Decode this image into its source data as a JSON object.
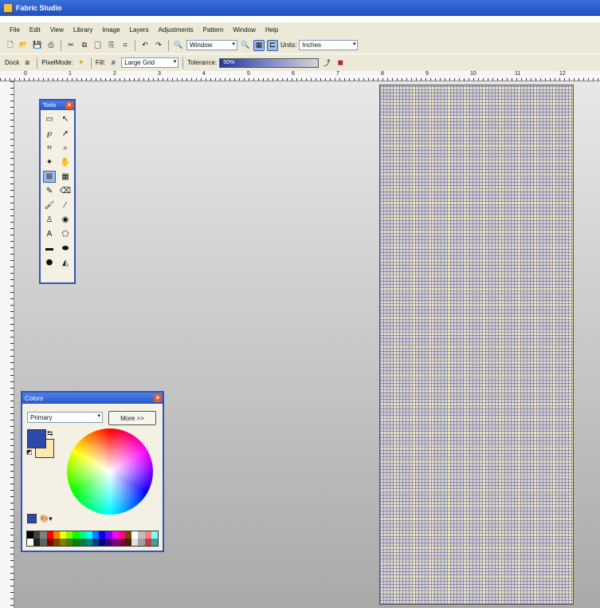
{
  "window": {
    "title": "Fabric Studio"
  },
  "menu": [
    "File",
    "Edit",
    "View",
    "Library",
    "Image",
    "Layers",
    "Adjustments",
    "Pattern",
    "Window",
    "Help"
  ],
  "toolbar1": {
    "zoom_value": "Window",
    "units_label": "Units:",
    "units_value": "Inches"
  },
  "toolbar2": {
    "dock_label": "Dock",
    "pixel_mode_label": "PixelMode:",
    "fill_label": "Fill:",
    "grid_value": "Large Grid",
    "tolerance_label": "Tolerance:",
    "tolerance_value": "50%"
  },
  "ruler_numbers": [
    "0",
    "1",
    "2",
    "3",
    "4",
    "5",
    "6",
    "7",
    "8",
    "9",
    "10",
    "11",
    "12"
  ],
  "tools_panel": {
    "title": "Tools"
  },
  "tools": [
    {
      "icon": "marquee-icon",
      "glyph": "▭"
    },
    {
      "icon": "move-icon",
      "glyph": "↖"
    },
    {
      "icon": "lasso-icon",
      "glyph": "℘"
    },
    {
      "icon": "pointer-icon",
      "glyph": "➚"
    },
    {
      "icon": "crop-icon",
      "glyph": "⌗"
    },
    {
      "icon": "zoom-icon",
      "glyph": "⌕"
    },
    {
      "icon": "magic-wand-icon",
      "glyph": "✦"
    },
    {
      "icon": "hand-icon",
      "glyph": "✋"
    },
    {
      "icon": "repeat-icon",
      "glyph": "⊞",
      "selected": true
    },
    {
      "icon": "pattern-icon",
      "glyph": "▦"
    },
    {
      "icon": "pencil-icon",
      "glyph": "✎"
    },
    {
      "icon": "eraser-icon",
      "glyph": "⌫"
    },
    {
      "icon": "brush-icon",
      "glyph": "🖌"
    },
    {
      "icon": "eyedropper-icon",
      "glyph": "⁄"
    },
    {
      "icon": "stamp-icon",
      "glyph": "♙"
    },
    {
      "icon": "fill-bucket-icon",
      "glyph": "◉"
    },
    {
      "icon": "text-icon",
      "glyph": "A"
    },
    {
      "icon": "shape-icon",
      "glyph": "⬠"
    },
    {
      "icon": "rectangle-icon",
      "glyph": "▬"
    },
    {
      "icon": "rounded-rect-icon",
      "glyph": "⬬"
    },
    {
      "icon": "ellipse-icon",
      "glyph": "⬣"
    },
    {
      "icon": "gradient-icon",
      "glyph": "◭"
    }
  ],
  "colors_panel": {
    "title": "Colors",
    "mode_value": "Primary",
    "more_label": "More >>"
  },
  "colors": {
    "primary": "#2e4aa8",
    "secondary": "#fbe9b0",
    "palette_top": [
      "#000000",
      "#404040",
      "#808080",
      "#ff0000",
      "#ff8000",
      "#ffff00",
      "#80ff00",
      "#00ff00",
      "#00ff80",
      "#00ffff",
      "#0080ff",
      "#0000ff",
      "#8000ff",
      "#ff00ff",
      "#ff0080",
      "#804000",
      "#ffffff",
      "#c0c0c0",
      "#ff8080",
      "#80ffff"
    ],
    "palette_bottom": [
      "#ffffff",
      "#202020",
      "#606060",
      "#800000",
      "#804000",
      "#808000",
      "#408000",
      "#008000",
      "#008040",
      "#008080",
      "#004080",
      "#000080",
      "#400080",
      "#800080",
      "#800040",
      "#402000",
      "#e0e0e0",
      "#a0a0a0",
      "#c04040",
      "#40a0a0"
    ]
  }
}
